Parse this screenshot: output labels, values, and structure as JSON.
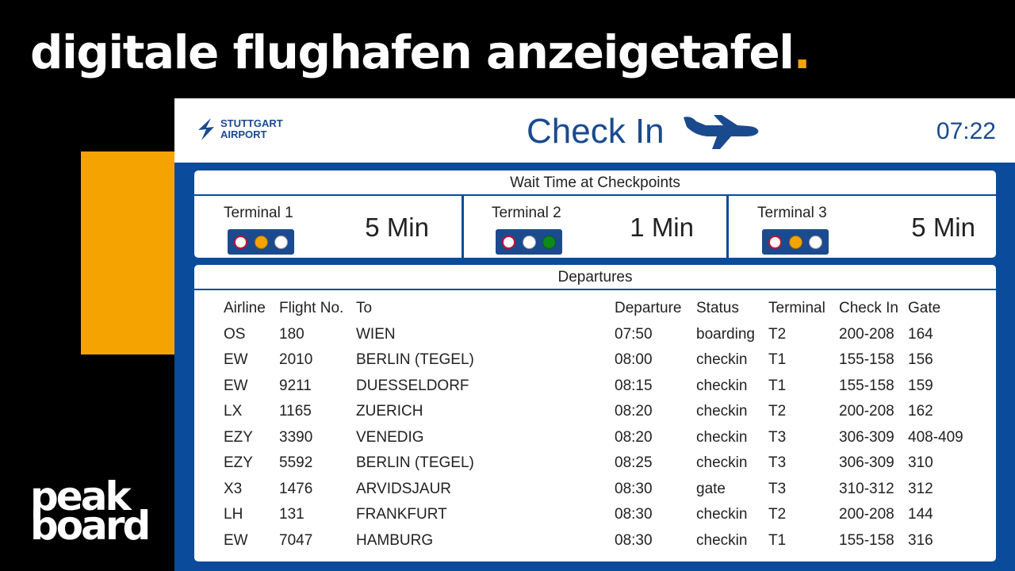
{
  "headline": {
    "text": "digitale flughafen anzeigetafel",
    "dot": "."
  },
  "brand_logo": {
    "line1": "peak",
    "line2": "board"
  },
  "header": {
    "airport_line1": "STUTTGART",
    "airport_line2": "AIRPORT",
    "title": "Check In",
    "icon": "airplane-icon",
    "time": "07:22"
  },
  "wait_times": {
    "title": "Wait Time at Checkpoints",
    "terminals": [
      {
        "name": "Terminal 1",
        "time": "5 Min",
        "light": "amber"
      },
      {
        "name": "Terminal 2",
        "time": "1 Min",
        "light": "green"
      },
      {
        "name": "Terminal 3",
        "time": "5 Min",
        "light": "amber"
      }
    ]
  },
  "departures": {
    "title": "Departures",
    "columns": [
      "Airline",
      "Flight No.",
      "To",
      "Departure",
      "Status",
      "Terminal",
      "Check In",
      "Gate"
    ],
    "rows": [
      [
        "OS",
        "180",
        "WIEN",
        "07:50",
        "boarding",
        "T2",
        "200-208",
        "164"
      ],
      [
        "EW",
        "2010",
        "BERLIN (TEGEL)",
        "08:00",
        "checkin",
        "T1",
        "155-158",
        "156"
      ],
      [
        "EW",
        "9211",
        "DUESSELDORF",
        "08:15",
        "checkin",
        "T1",
        "155-158",
        "159"
      ],
      [
        "LX",
        "1165",
        "ZUERICH",
        "08:20",
        "checkin",
        "T2",
        "200-208",
        "162"
      ],
      [
        "EZY",
        "3390",
        "VENEDIG",
        "08:20",
        "checkin",
        "T3",
        "306-309",
        "408-409"
      ],
      [
        "EZY",
        "5592",
        "BERLIN (TEGEL)",
        "08:25",
        "checkin",
        "T3",
        "306-309",
        "310"
      ],
      [
        "X3",
        "1476",
        "ARVIDSJAUR",
        "08:30",
        "gate",
        "T3",
        "310-312",
        "312"
      ],
      [
        "LH",
        "131",
        "FRANKFURT",
        "08:30",
        "checkin",
        "T2",
        "200-208",
        "144"
      ],
      [
        "EW",
        "7047",
        "HAMBURG",
        "08:30",
        "checkin",
        "T1",
        "155-158",
        "316"
      ]
    ]
  },
  "colors": {
    "accent": "#f5a300",
    "board_blue": "#0a4b9b",
    "text_blue": "#1a4a8e"
  }
}
